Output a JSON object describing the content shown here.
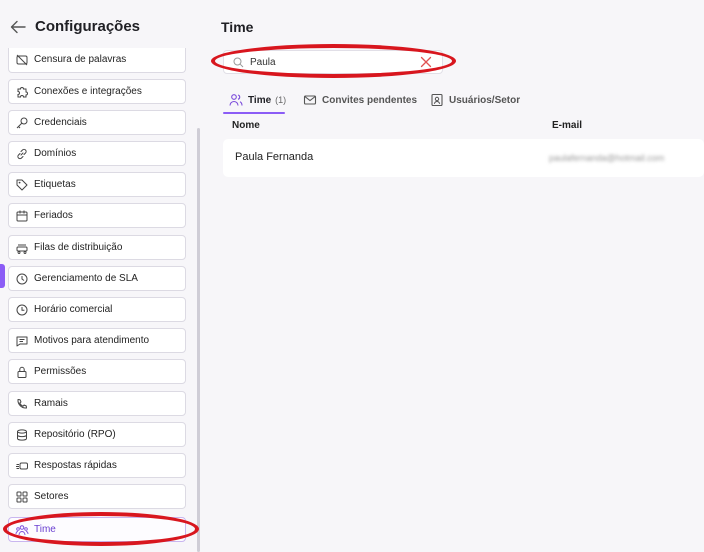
{
  "sidebar": {
    "title": "Configurações",
    "items": [
      {
        "label": "Censura de palavras",
        "icon": "no-text-icon"
      },
      {
        "label": "Conexões e integrações",
        "icon": "puzzle-icon"
      },
      {
        "label": "Credenciais",
        "icon": "key-icon"
      },
      {
        "label": "Domínios",
        "icon": "link-icon"
      },
      {
        "label": "Etiquetas",
        "icon": "tag-icon"
      },
      {
        "label": "Feriados",
        "icon": "calendar-icon"
      },
      {
        "label": "Filas de distribuição",
        "icon": "queue-icon"
      },
      {
        "label": "Gerenciamento de SLA",
        "icon": "sla-clock-icon"
      },
      {
        "label": "Horário comercial",
        "icon": "clock-icon"
      },
      {
        "label": "Motivos para atendimento",
        "icon": "message-icon"
      },
      {
        "label": "Permissões",
        "icon": "lock-icon"
      },
      {
        "label": "Ramais",
        "icon": "phone-icon"
      },
      {
        "label": "Repositório (RPO)",
        "icon": "database-icon"
      },
      {
        "label": "Respostas rápidas",
        "icon": "quick-reply-icon"
      },
      {
        "label": "Setores",
        "icon": "grid-icon"
      },
      {
        "label": "Time",
        "icon": "team-icon",
        "active": true
      }
    ]
  },
  "main": {
    "title": "Time",
    "search": {
      "value": "Paula"
    },
    "tabs": [
      {
        "label": "Time",
        "count": "(1)",
        "active": true,
        "icon": "users-icon"
      },
      {
        "label": "Convites pendentes",
        "icon": "mail-icon"
      },
      {
        "label": "Usuários/Setor",
        "icon": "contact-card-icon"
      }
    ],
    "table": {
      "columns": [
        "Nome",
        "E-mail"
      ],
      "rows": [
        {
          "name": "Paula Fernanda",
          "email": "paulafernanda@hotmail.com"
        }
      ]
    }
  },
  "colors": {
    "accent": "#8b5cf6",
    "annotation": "#d8161e",
    "clear_icon": "#e05252"
  }
}
